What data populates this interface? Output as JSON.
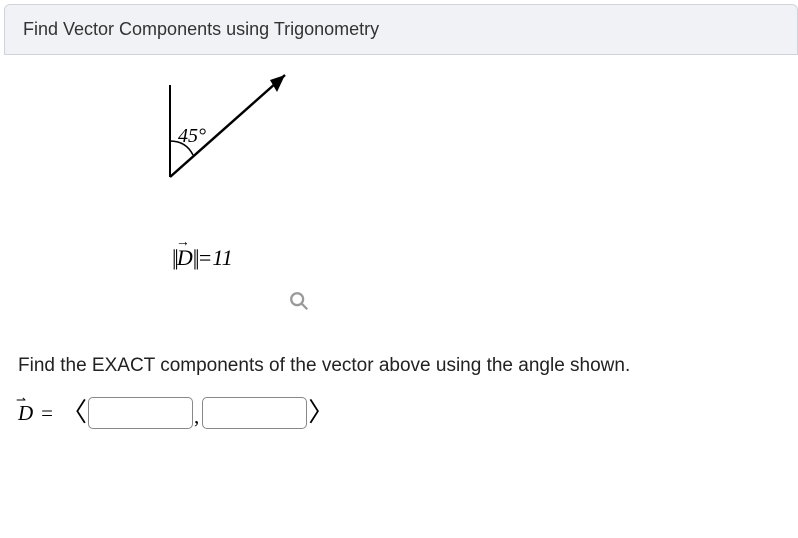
{
  "title": "Find Vector Components using Trigonometry",
  "figure": {
    "angle_label": "45°",
    "magnitude": {
      "bars_open": "||",
      "d": "D",
      "arrow": "→",
      "bars_close": "||",
      "eq": "=",
      "value": "11"
    }
  },
  "zoom_icon_name": "magnifier-icon",
  "prompt": "Find the EXACT components of the vector above using the angle shown.",
  "answer": {
    "d": "D",
    "arrow": "⇀",
    "eq": "=",
    "open": "〈",
    "close": "〉",
    "comma": ",",
    "x_value": "",
    "y_value": "",
    "x_placeholder": "",
    "y_placeholder": ""
  }
}
